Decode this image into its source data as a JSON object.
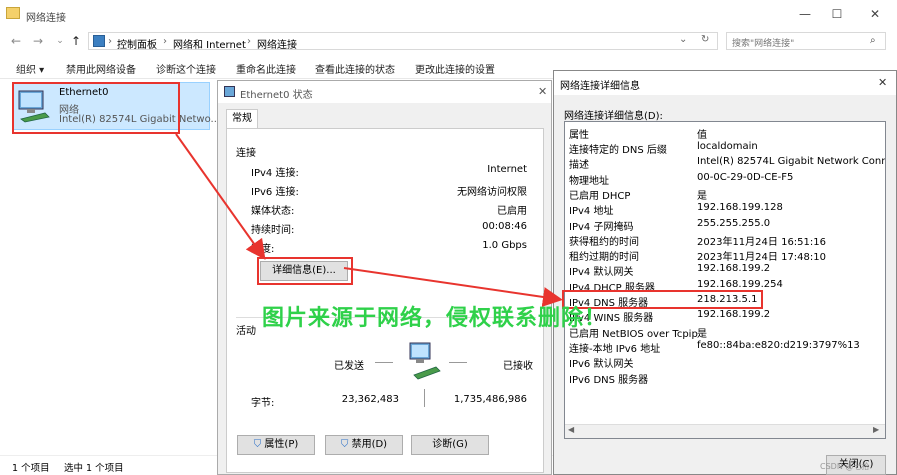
{
  "window": {
    "title": "网络连接",
    "min": "—",
    "max": "☐",
    "close": "✕"
  },
  "address": {
    "crumbs": [
      "控制面板",
      "网络和 Internet",
      "网络连接"
    ],
    "search_placeholder": "搜索\"网络连接\""
  },
  "commands": [
    "组织 ▾",
    "禁用此网络设备",
    "诊断这个连接",
    "重命名此连接",
    "查看此连接的状态",
    "更改此连接的设置"
  ],
  "adapter": {
    "name": "Ethernet0",
    "status": "网络",
    "device": "Intel(R) 82574L Gigabit Netwo..."
  },
  "statusbar": {
    "count": "1 个项目",
    "selected": "选中 1 个项目"
  },
  "status_dialog": {
    "title": "Ethernet0 状态",
    "tab": "常规",
    "section_connection": "连接",
    "rows": [
      {
        "label": "IPv4 连接:",
        "value": "Internet"
      },
      {
        "label": "IPv6 连接:",
        "value": "无网络访问权限"
      },
      {
        "label": "媒体状态:",
        "value": "已启用"
      },
      {
        "label": "持续时间:",
        "value": "00:08:46"
      },
      {
        "label": "速度:",
        "value": "1.0 Gbps"
      }
    ],
    "details_button": "详细信息(E)...",
    "section_activity": "活动",
    "sent_label": "已发送",
    "recv_label": "已接收",
    "bytes_label": "字节:",
    "bytes_sent": "23,362,483",
    "bytes_recv": "1,735,486,986",
    "btn_properties": "属性(P)",
    "btn_disable": "禁用(D)",
    "btn_diagnose": "诊断(G)"
  },
  "details_dialog": {
    "title": "网络连接详细信息",
    "caption": "网络连接详细信息(D):",
    "header": {
      "k": "属性",
      "v": "值"
    },
    "rows": [
      {
        "k": "连接特定的 DNS 后缀",
        "v": "localdomain"
      },
      {
        "k": "描述",
        "v": "Intel(R) 82574L Gigabit Network Connect"
      },
      {
        "k": "物理地址",
        "v": "00-0C-29-0D-CE-F5"
      },
      {
        "k": "已启用 DHCP",
        "v": "是"
      },
      {
        "k": "IPv4 地址",
        "v": "192.168.199.128"
      },
      {
        "k": "IPv4 子网掩码",
        "v": "255.255.255.0"
      },
      {
        "k": "获得租约的时间",
        "v": "2023年11月24日 16:51:16"
      },
      {
        "k": "租约过期的时间",
        "v": "2023年11月24日 17:48:10"
      },
      {
        "k": "IPv4 默认网关",
        "v": "192.168.199.2"
      },
      {
        "k": "IPv4 DHCP 服务器",
        "v": "192.168.199.254"
      },
      {
        "k": "IPv4 DNS 服务器",
        "v": "218.213.5.1"
      },
      {
        "k": "IPv4 WINS 服务器",
        "v": "192.168.199.2"
      },
      {
        "k": "已启用 NetBIOS over Tcpip",
        "v": "是"
      },
      {
        "k": "连接-本地 IPv6 地址",
        "v": "fe80::84ba:e820:d219:3797%13"
      },
      {
        "k": "IPv6 默认网关",
        "v": ""
      },
      {
        "k": "IPv6 DNS 服务器",
        "v": ""
      }
    ],
    "close_button": "关闭(C)"
  },
  "watermark": "图片来源于网络，侵权联系删除！",
  "corner_mark": "CSDN @七拾"
}
